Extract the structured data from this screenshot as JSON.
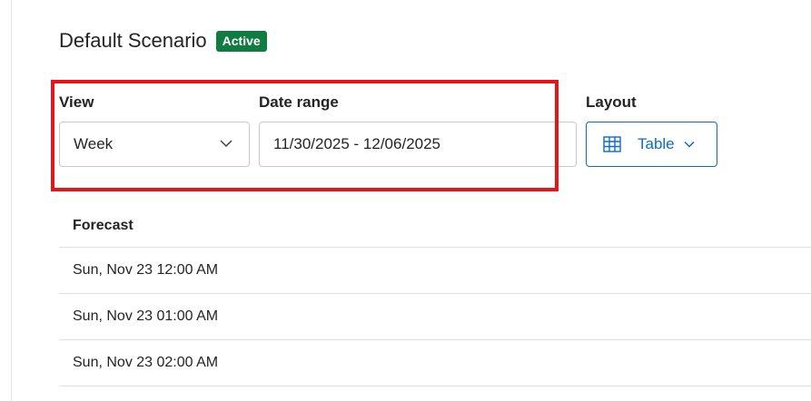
{
  "scenario": {
    "title": "Default Scenario",
    "status_badge": "Active"
  },
  "view": {
    "label": "View",
    "value": "Week"
  },
  "date_range": {
    "label": "Date range",
    "value": "11/30/2025 - 12/06/2025"
  },
  "layout": {
    "label": "Layout",
    "value": "Table",
    "icon": "table-icon"
  },
  "table": {
    "header": "Forecast",
    "rows": [
      "Sun, Nov 23 12:00 AM",
      "Sun, Nov 23 01:00 AM",
      "Sun, Nov 23 02:00 AM"
    ]
  },
  "colors": {
    "badge": "#107c41",
    "accent": "#0f6cbd",
    "highlight": "#e3161b"
  }
}
